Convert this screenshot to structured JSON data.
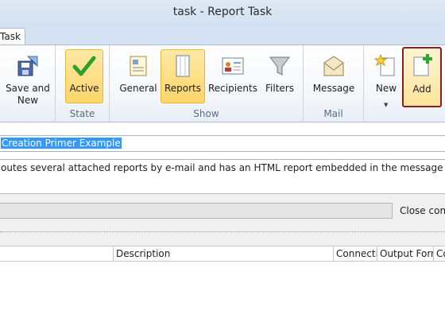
{
  "window": {
    "title": "task - Report Task"
  },
  "ribbon": {
    "tab_label": "Task",
    "groups": {
      "save": {
        "save_new_line1": "Save and",
        "save_new_line2": "New"
      },
      "state": {
        "label": "State",
        "active": "Active"
      },
      "show": {
        "label": "Show",
        "general": "General",
        "reports": "Reports",
        "recipients": "Recipients",
        "filters": "Filters"
      },
      "mail": {
        "label": "Mail",
        "message": "Message"
      },
      "other": {
        "new": "New",
        "add": "Add"
      }
    },
    "colors": {
      "highlight": "#fcd56b",
      "add_border": "#8a1c22"
    }
  },
  "task": {
    "name": "Creation Primer Example",
    "description": "outes several attached reports by e-mail and has an HTML report embedded in the message"
  },
  "connection": {
    "close_label": "Close conn"
  },
  "grid": {
    "columns": [
      "",
      "Description",
      "Connectio",
      "Output Form",
      "Co"
    ]
  }
}
